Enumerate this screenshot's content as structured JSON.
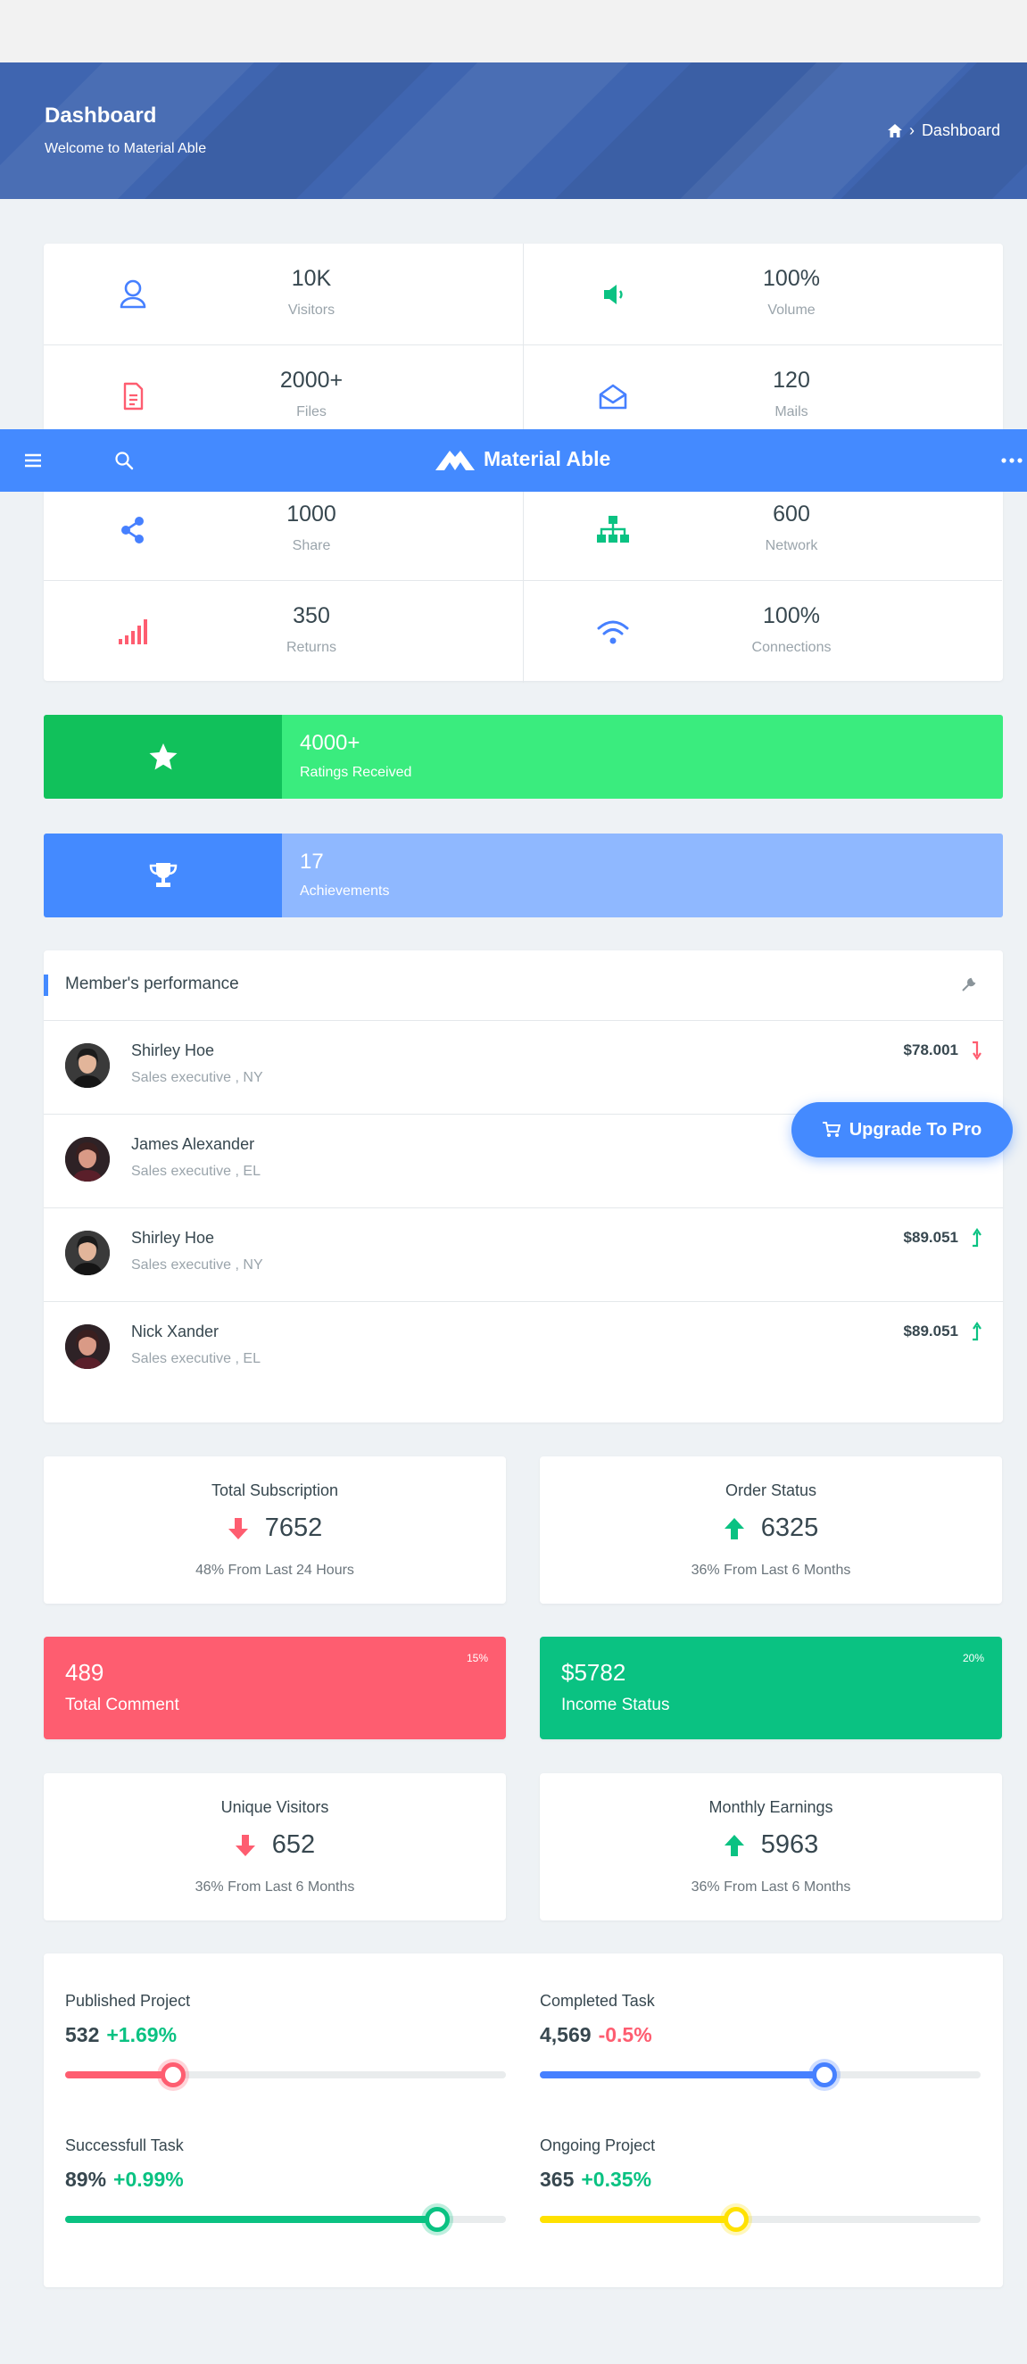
{
  "header": {
    "title": "Dashboard",
    "subtitle": "Welcome to Material Able",
    "breadcrumb": "Dashboard"
  },
  "navbar": {
    "brand": "Material Able"
  },
  "stats": [
    {
      "value": "10K",
      "label": "Visitors",
      "icon": "user-icon",
      "color": "#4680ff"
    },
    {
      "value": "100%",
      "label": "Volume",
      "icon": "volume-icon",
      "color": "#0ac282"
    },
    {
      "value": "2000+",
      "label": "Files",
      "icon": "file-icon",
      "color": "#fe5d70"
    },
    {
      "value": "120",
      "label": "Mails",
      "icon": "mail-icon",
      "color": "#4680ff"
    },
    {
      "value": "1000",
      "label": "Share",
      "icon": "share-icon",
      "color": "#4680ff"
    },
    {
      "value": "600",
      "label": "Network",
      "icon": "network-icon",
      "color": "#0ac282"
    },
    {
      "value": "350",
      "label": "Returns",
      "icon": "signal-icon",
      "color": "#fe5d70"
    },
    {
      "value": "100%",
      "label": "Connections",
      "icon": "wifi-icon",
      "color": "#4680ff"
    }
  ],
  "ratings": {
    "value": "4000+",
    "label": "Ratings Received",
    "icon": "star-icon"
  },
  "achievements": {
    "value": "17",
    "label": "Achievements",
    "icon": "trophy-icon"
  },
  "performance": {
    "title": "Member's performance",
    "members": [
      {
        "name": "Shirley Hoe",
        "role": "Sales executive , NY",
        "amount": "$78.001",
        "trend": "down"
      },
      {
        "name": "James Alexander",
        "role": "Sales executive , EL",
        "amount": "",
        "trend": ""
      },
      {
        "name": "Shirley Hoe",
        "role": "Sales executive , NY",
        "amount": "$89.051",
        "trend": "up"
      },
      {
        "name": "Nick Xander",
        "role": "Sales executive , EL",
        "amount": "$89.051",
        "trend": "up"
      }
    ]
  },
  "upgrade": {
    "label": "Upgrade To Pro"
  },
  "summaries": [
    {
      "title": "Total Subscription",
      "value": "7652",
      "trend": "down",
      "footer": "48% From Last 24 Hours"
    },
    {
      "title": "Order Status",
      "value": "6325",
      "trend": "up",
      "footer": "36% From Last 6 Months"
    },
    {
      "title": "Unique Visitors",
      "value": "652",
      "trend": "down",
      "footer": "36% From Last 6 Months"
    },
    {
      "title": "Monthly Earnings",
      "value": "5963",
      "trend": "up",
      "footer": "36% From Last 6 Months"
    }
  ],
  "comment": {
    "value": "489",
    "label": "Total Comment",
    "percent": "15%",
    "color": "#fe5d70"
  },
  "income": {
    "value": "$5782",
    "label": "Income Status",
    "percent": "20%",
    "color": "#0ac282"
  },
  "progress": [
    {
      "title": "Published Project",
      "value": "532",
      "delta": "+1.69%",
      "delta_color": "#0ac282",
      "level": 0.245,
      "color": "#fe5d70"
    },
    {
      "title": "Completed Task",
      "value": "4,569",
      "delta": "-0.5%",
      "delta_color": "#fe5d70",
      "level": 0.645,
      "color": "#4680ff"
    },
    {
      "title": "Successfull Task",
      "value": "89%",
      "delta": "+0.99%",
      "delta_color": "#0ac282",
      "level": 0.845,
      "color": "#0ac282"
    },
    {
      "title": "Ongoing Project",
      "value": "365",
      "delta": "+0.35%",
      "delta_color": "#0ac282",
      "level": 0.445,
      "color": "#ffe100"
    }
  ]
}
